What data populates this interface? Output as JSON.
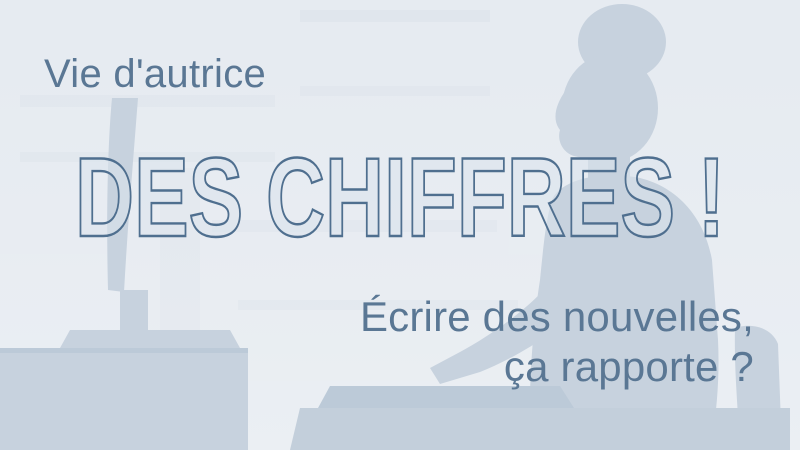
{
  "banner": {
    "kicker": "Vie d'autrice",
    "headline": "DES CHIFFRES !",
    "subtitle_line1": "Écrire des nouvelles,",
    "subtitle_line2": "ça rapporte ?"
  },
  "colors": {
    "background": "#e9edf2",
    "silhouette": "#c9d4e0",
    "silhouette_shadow": "#b7c5d4",
    "text": "#5a7794",
    "headline_outline": "#4f6f8f",
    "headline_fill": "#dbe3ec"
  },
  "icons": [
    "computer-monitor-silhouette",
    "woman-at-desk-silhouette",
    "keyboard-silhouette"
  ]
}
